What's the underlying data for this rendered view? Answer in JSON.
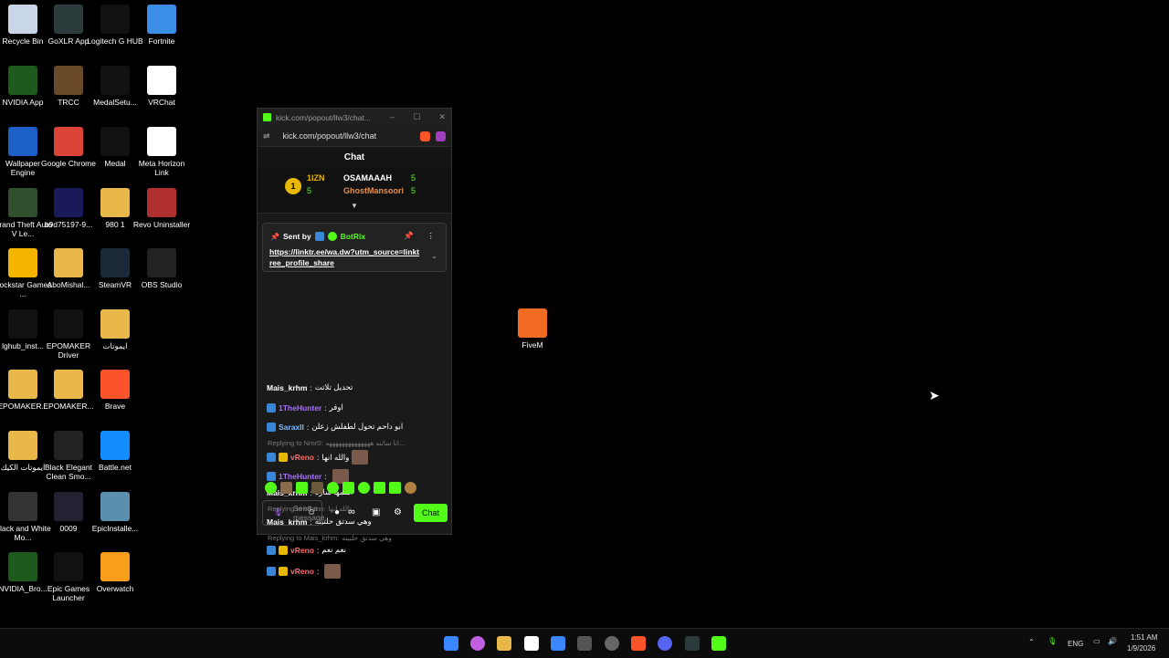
{
  "desktop": {
    "icons": [
      {
        "label": "Recycle Bin",
        "icon": "recycle-bin-icon",
        "color": "#c9d6e8"
      },
      {
        "label": "GoXLR App",
        "icon": "goxlr-icon",
        "color": "#2b3b3b"
      },
      {
        "label": "Logitech G HUB",
        "icon": "logitech-icon",
        "color": "#111111"
      },
      {
        "label": "Fortnite",
        "icon": "fortnite-icon",
        "color": "#3a8ee6"
      },
      {
        "label": "NVIDIA App",
        "icon": "nvidia-icon",
        "color": "#1e5a1e"
      },
      {
        "label": "TRCC",
        "icon": "trcc-icon",
        "color": "#6b4a2a"
      },
      {
        "label": "MedalSetu...",
        "icon": "medal-icon",
        "color": "#111111"
      },
      {
        "label": "VRChat",
        "icon": "vrchat-icon",
        "color": "#ffffff"
      },
      {
        "label": "Wallpaper Engine",
        "icon": "wallpaper-engine-icon",
        "color": "#1b5fc7"
      },
      {
        "label": "Google Chrome",
        "icon": "chrome-icon",
        "color": "#db4437"
      },
      {
        "label": "Medal",
        "icon": "medal-icon",
        "color": "#111111"
      },
      {
        "label": "Meta Horizon Link",
        "icon": "meta-icon",
        "color": "#ffffff"
      },
      {
        "label": "Grand Theft Auto V Le...",
        "icon": "gta-icon",
        "color": "#2f4f2f"
      },
      {
        "label": "b9d75197-9...",
        "icon": "file-icon",
        "color": "#1a1a5a"
      },
      {
        "label": "980 1",
        "icon": "folder-icon",
        "color": "#e8b84a"
      },
      {
        "label": "Revo Uninstaller",
        "icon": "revo-icon",
        "color": "#b03030"
      },
      {
        "label": "Rockstar Games ...",
        "icon": "rockstar-icon",
        "color": "#f4b400"
      },
      {
        "label": "AboMishal...",
        "icon": "folder-icon",
        "color": "#e8b84a"
      },
      {
        "label": "SteamVR",
        "icon": "steamvr-icon",
        "color": "#1b2838"
      },
      {
        "label": "OBS Studio",
        "icon": "obs-icon",
        "color": "#222222"
      },
      {
        "label": "lghub_inst...",
        "icon": "logitech-icon",
        "color": "#111111"
      },
      {
        "label": "EPOMAKER Driver",
        "icon": "epomaker-icon",
        "color": "#111111"
      },
      {
        "label": "ايموتات",
        "icon": "folder-icon",
        "color": "#e8b84a"
      },
      {
        "label": "EPOMAKER...",
        "icon": "folder-icon",
        "color": "#e8b84a"
      },
      {
        "label": "EPOMAKER...",
        "icon": "folder-icon",
        "color": "#e8b84a"
      },
      {
        "label": "Brave",
        "icon": "brave-icon",
        "color": "#fb542b"
      },
      {
        "label": "ايموتات الكيك",
        "icon": "folder-icon",
        "color": "#e8b84a"
      },
      {
        "label": "Black Elegant Clean Smo...",
        "icon": "video-icon",
        "color": "#222222"
      },
      {
        "label": "Battle.net",
        "icon": "battlenet-icon",
        "color": "#148eff"
      },
      {
        "label": "Black and White Mo...",
        "icon": "video-icon",
        "color": "#333333"
      },
      {
        "label": "0009",
        "icon": "video-icon",
        "color": "#222233"
      },
      {
        "label": "EpicInstalle...",
        "icon": "installer-icon",
        "color": "#5a8fb0"
      },
      {
        "label": "NVIDIA_Bro...",
        "icon": "nvidia-icon",
        "color": "#1e5a1e"
      },
      {
        "label": "Epic Games Launcher",
        "icon": "epic-icon",
        "color": "#111111"
      },
      {
        "label": "Overwatch",
        "icon": "overwatch-icon",
        "color": "#f99e1a"
      },
      {
        "label": "FiveM",
        "icon": "fivem-icon",
        "color": "#f26b22"
      }
    ]
  },
  "browser": {
    "title": "kick.com/popout/llw3/chat...",
    "address": "kick.com/popout/llw3/chat",
    "brand_color": "#53fc18"
  },
  "chat": {
    "header": "Chat",
    "leaderboard": {
      "rank": "1",
      "top_name": "1IZN",
      "top_count": "5",
      "second_name": "OSAMAAAH",
      "second_count": "5",
      "third_name": "GhostMansoori",
      "third_count": "5"
    },
    "pinned": {
      "sent_by": "Sent by",
      "author": "BotRix",
      "link": "https://linktr.ee/wa.dw?utm_source=linktree_profile_share"
    },
    "messages": [
      {
        "user": "Mais_krhm",
        "text": "تحديل تلاتت",
        "color": "#ffffff"
      },
      {
        "user": "1TheHunter",
        "text": "اوفر",
        "color": "#a970ff"
      },
      {
        "user": "SaraxII",
        "text": "ابو داحم تحول لطفلش زعلن",
        "color": "#7ab7ff"
      },
      {
        "reply": "Replying to Nrnr0:",
        "reply_text": "انا ساتنه ههههههههههههههه..."
      },
      {
        "user": "vReno",
        "text": "والله انها",
        "color": "#ff6b6b"
      },
      {
        "user": "1TheHunter",
        "text": "",
        "color": "#a970ff"
      },
      {
        "user": "Mais_krhm",
        "text": "اسمها ساره",
        "color": "#ffffff"
      },
      {
        "reply": "Replying to vReno:",
        "reply_text": "والله انها"
      },
      {
        "user": "Mais_krhm",
        "text": "وهي سدتق حلتيته",
        "color": "#ffffff"
      },
      {
        "reply": "Replying to Mais_krhm:",
        "reply_text": "وهي سدتق حلتيته"
      },
      {
        "user": "vReno",
        "text": "نعم نعم",
        "color": "#ff6b6b"
      },
      {
        "user": "vReno",
        "text": "",
        "color": "#ff6b6b"
      }
    ],
    "input_placeholder": "Send a message",
    "send_label": "Chat"
  },
  "taskbar": {
    "lang": "ENG",
    "time": "1:51 AM",
    "date": "1/9/2026"
  }
}
